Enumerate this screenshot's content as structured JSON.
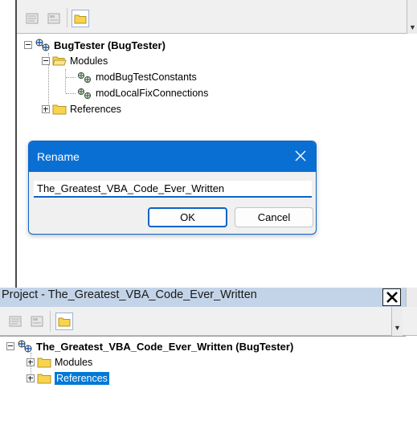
{
  "top_pane": {
    "toolbar": {
      "view_code_icon": "view-code-icon",
      "view_object_icon": "view-object-icon",
      "toggle_folders_icon": "folder-icon"
    },
    "tree": {
      "project_label": "BugTester (BugTester)",
      "modules_label": "Modules",
      "modules": [
        "modBugTestConstants",
        "modLocalFixConnections"
      ],
      "references_label": "References"
    }
  },
  "rename_dialog": {
    "title": "Rename",
    "input_value": "The_Greatest_VBA_Code_Ever_Written",
    "ok_label": "OK",
    "cancel_label": "Cancel"
  },
  "bottom_pane": {
    "title": "Project - The_Greatest_VBA_Code_Ever_Written",
    "close_glyph": "X",
    "tree": {
      "project_label": "The_Greatest_VBA_Code_Ever_Written (BugTester)",
      "modules_label": "Modules",
      "references_label": "References"
    }
  },
  "colors": {
    "dialog_titlebar": "#0a6fd3",
    "selection": "#0078d7",
    "panel_titlebar": "#c3d4e8"
  }
}
